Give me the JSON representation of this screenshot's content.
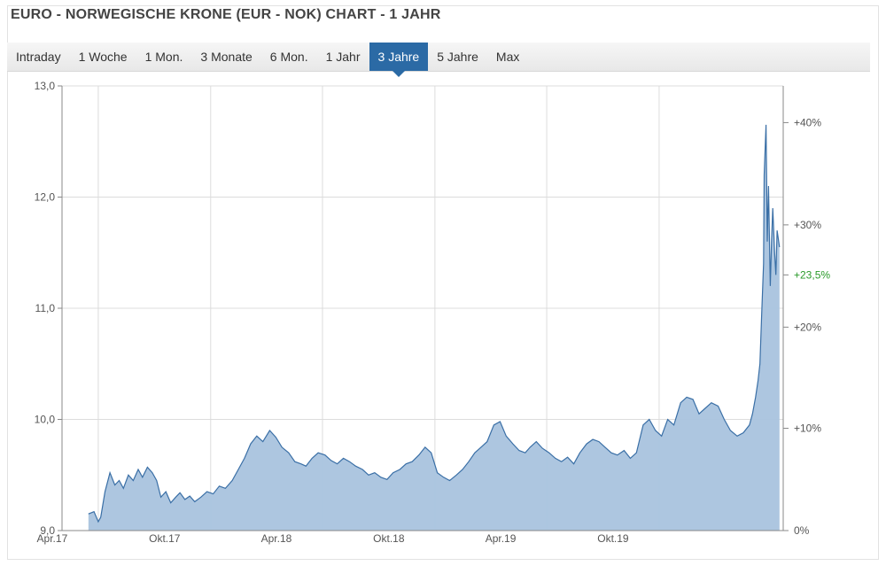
{
  "title": "EURO - NORWEGISCHE KRONE (EUR - NOK) CHART - 1 JAHR",
  "tabs": [
    {
      "label": "Intraday",
      "active": false
    },
    {
      "label": "1 Woche",
      "active": false
    },
    {
      "label": "1 Mon.",
      "active": false
    },
    {
      "label": "3 Monate",
      "active": false
    },
    {
      "label": "6 Mon.",
      "active": false
    },
    {
      "label": "1 Jahr",
      "active": false
    },
    {
      "label": "3 Jahre",
      "active": true
    },
    {
      "label": "5 Jahre",
      "active": false
    },
    {
      "label": "Max",
      "active": false
    }
  ],
  "colors": {
    "line": "#3a6fa6",
    "area": "#a9c3de",
    "grid": "#dcdcdc",
    "active_tab": "#2b6aa5",
    "current_pct": "#2a9a2a"
  },
  "chart_data": {
    "type": "area",
    "x": [
      "2017-03-16",
      "2017-03-25",
      "2017-04-01",
      "2017-04-05",
      "2017-04-12",
      "2017-04-20",
      "2017-04-28",
      "2017-05-05",
      "2017-05-12",
      "2017-05-20",
      "2017-05-28",
      "2017-06-05",
      "2017-06-12",
      "2017-06-20",
      "2017-06-28",
      "2017-07-05",
      "2017-07-12",
      "2017-07-20",
      "2017-07-28",
      "2017-08-05",
      "2017-08-12",
      "2017-08-20",
      "2017-08-28",
      "2017-09-05",
      "2017-09-15",
      "2017-09-25",
      "2017-10-05",
      "2017-10-15",
      "2017-10-25",
      "2017-11-05",
      "2017-11-15",
      "2017-11-25",
      "2017-12-05",
      "2017-12-15",
      "2017-12-25",
      "2018-01-05",
      "2018-01-15",
      "2018-01-25",
      "2018-02-05",
      "2018-02-15",
      "2018-02-25",
      "2018-03-05",
      "2018-03-15",
      "2018-03-25",
      "2018-04-05",
      "2018-04-15",
      "2018-04-25",
      "2018-05-05",
      "2018-05-15",
      "2018-05-25",
      "2018-06-05",
      "2018-06-15",
      "2018-06-25",
      "2018-07-05",
      "2018-07-15",
      "2018-07-25",
      "2018-08-05",
      "2018-08-15",
      "2018-08-25",
      "2018-09-05",
      "2018-09-15",
      "2018-09-25",
      "2018-10-05",
      "2018-10-15",
      "2018-10-25",
      "2018-11-05",
      "2018-11-15",
      "2018-11-25",
      "2018-12-05",
      "2018-12-15",
      "2018-12-25",
      "2019-01-05",
      "2019-01-15",
      "2019-01-25",
      "2019-02-05",
      "2019-02-15",
      "2019-02-25",
      "2019-03-05",
      "2019-03-15",
      "2019-03-25",
      "2019-04-05",
      "2019-04-15",
      "2019-04-25",
      "2019-05-05",
      "2019-05-15",
      "2019-05-25",
      "2019-06-05",
      "2019-06-15",
      "2019-06-25",
      "2019-07-05",
      "2019-07-15",
      "2019-07-25",
      "2019-08-05",
      "2019-08-15",
      "2019-08-25",
      "2019-09-05",
      "2019-09-15",
      "2019-09-25",
      "2019-10-05",
      "2019-10-15",
      "2019-10-25",
      "2019-11-05",
      "2019-11-15",
      "2019-11-25",
      "2019-12-05",
      "2019-12-15",
      "2019-12-25",
      "2020-01-05",
      "2020-01-15",
      "2020-01-25",
      "2020-02-05",
      "2020-02-15",
      "2020-02-25",
      "2020-03-01",
      "2020-03-06",
      "2020-03-10",
      "2020-03-13",
      "2020-03-16",
      "2020-03-19",
      "2020-03-20",
      "2020-03-23",
      "2020-03-25",
      "2020-03-27",
      "2020-03-30",
      "2020-04-01",
      "2020-04-03",
      "2020-04-06",
      "2020-04-08",
      "2020-04-10",
      "2020-04-14"
    ],
    "values": [
      9.15,
      9.17,
      9.08,
      9.12,
      9.35,
      9.52,
      9.41,
      9.45,
      9.38,
      9.5,
      9.45,
      9.55,
      9.48,
      9.57,
      9.52,
      9.45,
      9.3,
      9.35,
      9.25,
      9.3,
      9.34,
      9.28,
      9.31,
      9.26,
      9.3,
      9.35,
      9.33,
      9.4,
      9.38,
      9.45,
      9.55,
      9.65,
      9.78,
      9.85,
      9.8,
      9.9,
      9.84,
      9.75,
      9.7,
      9.62,
      9.6,
      9.58,
      9.65,
      9.7,
      9.68,
      9.63,
      9.6,
      9.65,
      9.62,
      9.58,
      9.55,
      9.5,
      9.52,
      9.48,
      9.46,
      9.52,
      9.55,
      9.6,
      9.62,
      9.68,
      9.75,
      9.7,
      9.52,
      9.48,
      9.45,
      9.5,
      9.55,
      9.62,
      9.7,
      9.75,
      9.8,
      9.95,
      9.98,
      9.85,
      9.78,
      9.72,
      9.7,
      9.75,
      9.8,
      9.74,
      9.7,
      9.65,
      9.62,
      9.66,
      9.6,
      9.7,
      9.78,
      9.82,
      9.8,
      9.75,
      9.7,
      9.68,
      9.72,
      9.65,
      9.7,
      9.95,
      10.0,
      9.9,
      9.85,
      10.0,
      9.95,
      10.15,
      10.2,
      10.18,
      10.05,
      10.1,
      10.15,
      10.12,
      10.0,
      9.9,
      9.85,
      9.88,
      9.95,
      10.05,
      10.2,
      10.35,
      10.5,
      10.95,
      11.4,
      12.2,
      12.65,
      11.6,
      12.1,
      11.2,
      11.6,
      11.9,
      11.5,
      11.3,
      11.7,
      11.55,
      11.3
    ],
    "xtick_labels": [
      "Apr.17",
      "Okt.17",
      "Apr.18",
      "Okt.18",
      "Apr.19",
      "Okt.19"
    ],
    "xtick_dates": [
      "2017-04-01",
      "2017-10-01",
      "2018-04-01",
      "2018-10-01",
      "2019-04-01",
      "2019-10-01"
    ],
    "x_range": [
      "2017-02-01",
      "2020-04-20"
    ],
    "ylim": [
      9.0,
      13.0
    ],
    "yticks": [
      9.0,
      10.0,
      11.0,
      12.0,
      13.0
    ],
    "ytick_labels": [
      "9,0",
      "10,0",
      "11,0",
      "12,0",
      "13,0"
    ],
    "right_axis": {
      "labels": [
        "0%",
        "+10%",
        "+20%",
        "+30%",
        "+40%"
      ],
      "values": [
        9.0,
        9.92,
        10.83,
        11.75,
        12.67
      ]
    },
    "current_marker": {
      "label": "+23,5%",
      "value": 11.3
    },
    "grid": true
  }
}
